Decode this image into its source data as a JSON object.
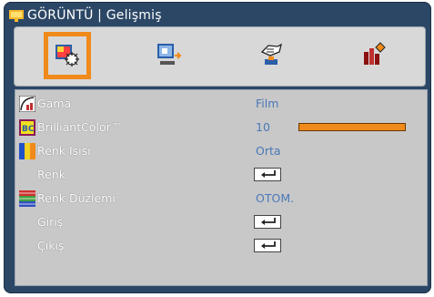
{
  "window": {
    "title": "GÖRÜNTÜ | Gelişmiş"
  },
  "tabs": [
    {
      "name": "picture-tab",
      "selected": true
    },
    {
      "name": "display-tab",
      "selected": false
    },
    {
      "name": "setup-tab",
      "selected": false
    },
    {
      "name": "options-tab",
      "selected": false
    }
  ],
  "menu": {
    "items": [
      {
        "label": "Gama",
        "value": "Film"
      },
      {
        "label": "BrilliantColor™",
        "value": "10",
        "slider_fraction": 1.0
      },
      {
        "label": "Renk Isısı",
        "value": "Orta"
      },
      {
        "label": "Renk",
        "value": ""
      },
      {
        "label": "Renk Düzlemi",
        "value": "OTOM."
      },
      {
        "label": "Giriş",
        "value": ""
      },
      {
        "label": "Çıkış",
        "value": ""
      }
    ]
  },
  "colors": {
    "frame": "#2c4766",
    "accent": "#f08a1a",
    "value_text": "#4a78b8"
  }
}
